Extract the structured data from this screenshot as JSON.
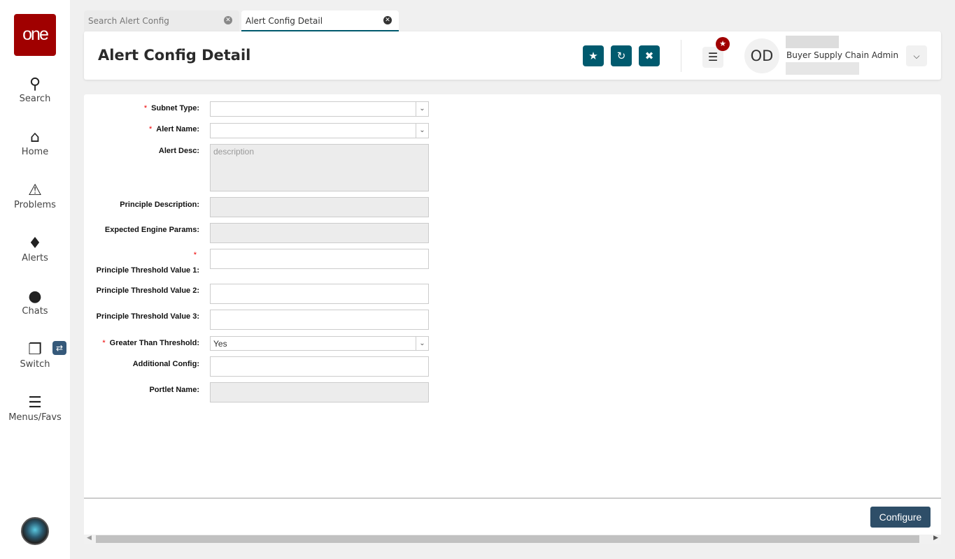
{
  "sidebar": {
    "logo": "one",
    "items": [
      {
        "label": "Search",
        "icon": "search-icon",
        "glyph": "🔍"
      },
      {
        "label": "Home",
        "icon": "home-icon",
        "glyph": "⌂"
      },
      {
        "label": "Problems",
        "icon": "warning-icon",
        "glyph": "⚠"
      },
      {
        "label": "Alerts",
        "icon": "bell-icon",
        "glyph": "🔔"
      },
      {
        "label": "Chats",
        "icon": "chat-icon",
        "glyph": "💬"
      },
      {
        "label": "Switch",
        "icon": "switch-icon",
        "glyph": "❐"
      },
      {
        "label": "Menus/Favs",
        "icon": "menu-icon",
        "glyph": "☰"
      }
    ]
  },
  "tabs": [
    {
      "label": "Search Alert Config"
    },
    {
      "label": "Alert Config Detail"
    }
  ],
  "header": {
    "title": "Alert Config Detail",
    "user_initials": "OD",
    "user_role": "Buyer Supply Chain Admin"
  },
  "form": {
    "subnet_type": {
      "label": "Subnet Type:",
      "value": ""
    },
    "alert_name": {
      "label": "Alert Name:",
      "value": ""
    },
    "alert_desc": {
      "label": "Alert Desc:",
      "placeholder": "description"
    },
    "principle_description": {
      "label": "Principle Description:"
    },
    "expected_engine_params": {
      "label": "Expected Engine Params:"
    },
    "ptv1": {
      "label": "Principle Threshold Value 1:"
    },
    "ptv2": {
      "label": "Principle Threshold Value 2:"
    },
    "ptv3": {
      "label": "Principle Threshold Value 3:"
    },
    "greater_than": {
      "label": "Greater Than Threshold:",
      "value": "Yes"
    },
    "additional_config": {
      "label": "Additional Config:"
    },
    "portlet_name": {
      "label": "Portlet Name:"
    },
    "required_mark": "*"
  },
  "footer": {
    "configure_label": "Configure"
  }
}
